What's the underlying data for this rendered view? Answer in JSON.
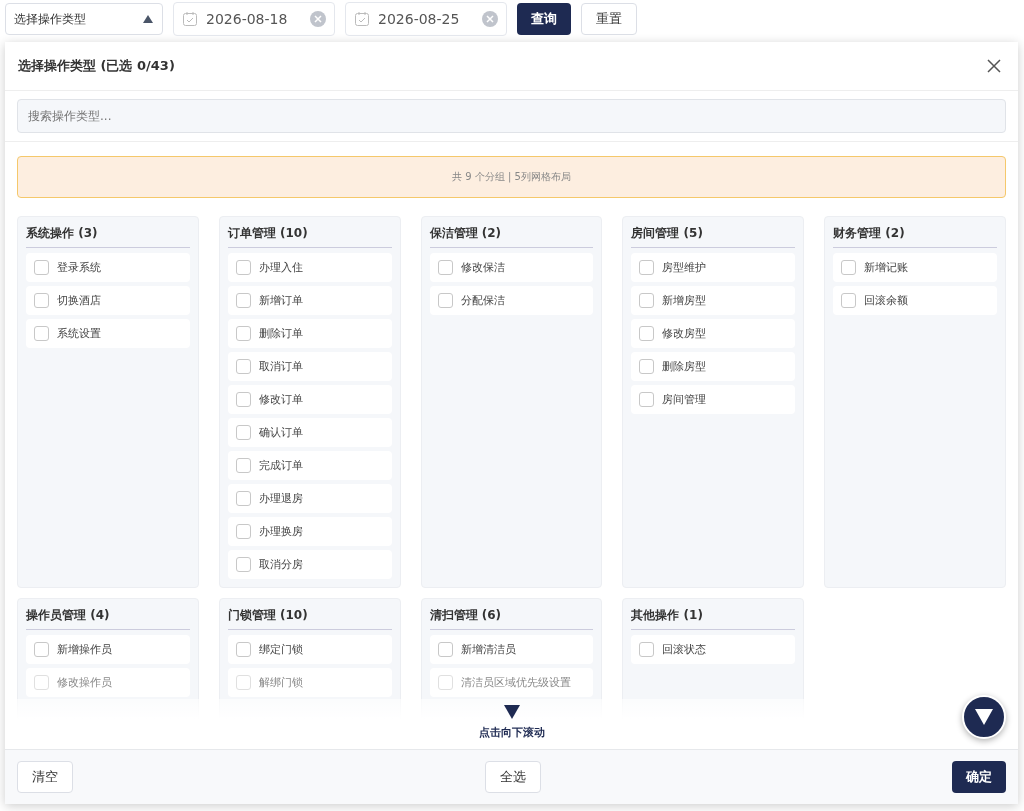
{
  "filter_bar": {
    "type_select": {
      "placeholder": "选择操作类型",
      "expanded": true
    },
    "start_date": "2026-08-18",
    "end_date": "2026-08-25",
    "buttons": [
      {
        "label": "查询",
        "kind": "primary"
      },
      {
        "label": "重置",
        "kind": "default"
      }
    ]
  },
  "dialog": {
    "title": "选择操作类型 (已选 0/43)",
    "search": {
      "placeholder": "搜索操作类型..."
    },
    "info": "共 9 个分组 | 5列网格布局",
    "groups": [
      {
        "title": "系统操作 (3)",
        "items": [
          {
            "label": "登录系统",
            "checked": false,
            "faded": false
          },
          {
            "label": "切换酒店",
            "checked": false,
            "faded": false
          },
          {
            "label": "系统设置",
            "checked": false,
            "faded": false
          }
        ]
      },
      {
        "title": "订单管理 (10)",
        "items": [
          {
            "label": "办理入住",
            "checked": false,
            "faded": false
          },
          {
            "label": "新增订单",
            "checked": false,
            "faded": false
          },
          {
            "label": "删除订单",
            "checked": false,
            "faded": false
          },
          {
            "label": "取消订单",
            "checked": false,
            "faded": false
          },
          {
            "label": "修改订单",
            "checked": false,
            "faded": false
          },
          {
            "label": "确认订单",
            "checked": false,
            "faded": false
          },
          {
            "label": "完成订单",
            "checked": false,
            "faded": false
          },
          {
            "label": "办理退房",
            "checked": false,
            "faded": false
          },
          {
            "label": "办理换房",
            "checked": false,
            "faded": false
          },
          {
            "label": "取消分房",
            "checked": false,
            "faded": false
          }
        ]
      },
      {
        "title": "保洁管理 (2)",
        "items": [
          {
            "label": "修改保洁",
            "checked": false,
            "faded": false
          },
          {
            "label": "分配保洁",
            "checked": false,
            "faded": false
          }
        ]
      },
      {
        "title": "房间管理 (5)",
        "items": [
          {
            "label": "房型维护",
            "checked": false,
            "faded": false
          },
          {
            "label": "新增房型",
            "checked": false,
            "faded": false
          },
          {
            "label": "修改房型",
            "checked": false,
            "faded": false
          },
          {
            "label": "删除房型",
            "checked": false,
            "faded": false
          },
          {
            "label": "房间管理",
            "checked": false,
            "faded": false
          }
        ]
      },
      {
        "title": "财务管理 (2)",
        "items": [
          {
            "label": "新增记账",
            "checked": false,
            "faded": false
          },
          {
            "label": "回滚余额",
            "checked": false,
            "faded": false
          }
        ]
      },
      {
        "title": "操作员管理 (4)",
        "items": [
          {
            "label": "新增操作员",
            "checked": false,
            "faded": false
          },
          {
            "label": "修改操作员",
            "checked": false,
            "faded": true
          }
        ]
      },
      {
        "title": "门锁管理 (10)",
        "items": [
          {
            "label": "绑定门锁",
            "checked": false,
            "faded": false
          },
          {
            "label": "解绑门锁",
            "checked": false,
            "faded": true
          }
        ]
      },
      {
        "title": "清扫管理 (6)",
        "items": [
          {
            "label": "新增清洁员",
            "checked": false,
            "faded": false
          },
          {
            "label": "清洁员区域优先级设置",
            "checked": false,
            "faded": true
          }
        ]
      },
      {
        "title": "其他操作 (1)",
        "items": [
          {
            "label": "回滚状态",
            "checked": false,
            "faded": false
          }
        ]
      }
    ],
    "scroll_hint": "点击向下滚动",
    "footer": {
      "clear": "清空",
      "select_all": "全选",
      "confirm": "确定"
    }
  }
}
